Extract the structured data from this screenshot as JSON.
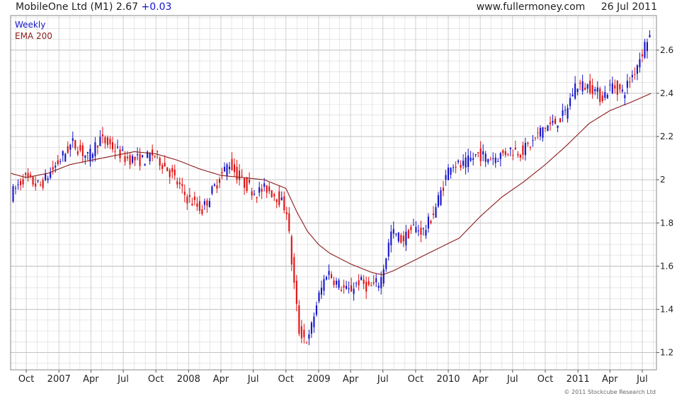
{
  "header": {
    "symbol": "MobileOne Ltd (M1)",
    "last": "2.67",
    "change": "+0.03",
    "site": "www.fullermoney.com",
    "date": "26 Jul 2011"
  },
  "footer": {
    "copyright": "© 2011 Stockcube Research Ltd"
  },
  "colors": {
    "up": "#1414c8",
    "down": "#e01010",
    "ema": "#8b1a1a",
    "grid": "#d8d8d8",
    "frame": "#888888"
  },
  "chart_data": {
    "type": "candlestick",
    "legend": {
      "placement": "top-left",
      "items": [
        {
          "label": "Weekly",
          "color": "#1414c8"
        },
        {
          "label": "EMA 200",
          "color": "#8b1a1a"
        }
      ]
    },
    "ylim": [
      1.12,
      2.76
    ],
    "yticks": [
      1.2,
      1.4,
      1.6,
      1.8,
      2.0,
      2.2,
      2.4,
      2.6
    ],
    "ytick_labels": [
      "1.2",
      "1.4",
      "1.6",
      "1.8",
      "2",
      "2.2",
      "2.4",
      "2.6"
    ],
    "xlim": [
      "2006-08-18",
      "2011-08-10"
    ],
    "xticks": [
      "2006-10-01",
      "2007-01-01",
      "2007-04-01",
      "2007-07-01",
      "2007-10-01",
      "2008-01-01",
      "2008-04-01",
      "2008-07-01",
      "2008-10-01",
      "2009-01-01",
      "2009-04-01",
      "2009-07-01",
      "2009-10-01",
      "2010-01-01",
      "2010-04-01",
      "2010-07-01",
      "2010-10-01",
      "2011-01-01",
      "2011-04-01",
      "2011-07-01"
    ],
    "xtick_labels": [
      "Oct",
      "2007",
      "Apr",
      "Jul",
      "Oct",
      "2008",
      "Apr",
      "Jul",
      "Oct",
      "2009",
      "Apr",
      "Jul",
      "Oct",
      "2010",
      "Apr",
      "Jul",
      "Oct",
      "2011",
      "Apr",
      "Jul"
    ],
    "grid": true,
    "price_keypoints": [
      [
        "2006-08-25",
        1.93
      ],
      [
        "2006-10-01",
        2.01
      ],
      [
        "2006-11-15",
        1.97
      ],
      [
        "2007-01-01",
        2.07
      ],
      [
        "2007-02-15",
        2.17
      ],
      [
        "2007-04-01",
        2.1
      ],
      [
        "2007-05-01",
        2.19
      ],
      [
        "2007-06-01",
        2.16
      ],
      [
        "2007-07-15",
        2.1
      ],
      [
        "2007-09-01",
        2.09
      ],
      [
        "2007-10-01",
        2.12
      ],
      [
        "2007-11-15",
        2.04
      ],
      [
        "2008-01-01",
        1.92
      ],
      [
        "2008-02-15",
        1.86
      ],
      [
        "2008-04-01",
        2.0
      ],
      [
        "2008-05-01",
        2.08
      ],
      [
        "2008-06-01",
        2.0
      ],
      [
        "2008-07-15",
        1.94
      ],
      [
        "2008-08-15",
        1.96
      ],
      [
        "2008-09-15",
        1.92
      ],
      [
        "2008-10-10",
        1.86
      ],
      [
        "2008-10-24",
        1.62
      ],
      [
        "2008-11-14",
        1.3
      ],
      [
        "2008-12-10",
        1.25
      ],
      [
        "2009-01-01",
        1.42
      ],
      [
        "2009-02-01",
        1.58
      ],
      [
        "2009-03-01",
        1.52
      ],
      [
        "2009-04-01",
        1.48
      ],
      [
        "2009-05-01",
        1.53
      ],
      [
        "2009-06-01",
        1.5
      ],
      [
        "2009-07-01",
        1.53
      ],
      [
        "2009-08-01",
        1.76
      ],
      [
        "2009-09-01",
        1.72
      ],
      [
        "2009-10-01",
        1.78
      ],
      [
        "2009-11-01",
        1.76
      ],
      [
        "2009-12-01",
        1.86
      ],
      [
        "2010-01-15",
        2.08
      ],
      [
        "2010-02-15",
        2.06
      ],
      [
        "2010-04-01",
        2.12
      ],
      [
        "2010-05-01",
        2.1
      ],
      [
        "2010-06-01",
        2.11
      ],
      [
        "2010-07-01",
        2.14
      ],
      [
        "2010-08-01",
        2.13
      ],
      [
        "2010-09-01",
        2.17
      ],
      [
        "2010-10-01",
        2.24
      ],
      [
        "2010-11-01",
        2.26
      ],
      [
        "2010-12-01",
        2.3
      ],
      [
        "2011-01-01",
        2.44
      ],
      [
        "2011-02-15",
        2.43
      ],
      [
        "2011-03-15",
        2.38
      ],
      [
        "2011-04-15",
        2.44
      ],
      [
        "2011-05-15",
        2.4
      ],
      [
        "2011-06-15",
        2.5
      ],
      [
        "2011-07-26",
        2.67
      ]
    ],
    "ema200_keypoints": [
      [
        "2006-08-18",
        2.03
      ],
      [
        "2006-10-01",
        2.01
      ],
      [
        "2006-12-01",
        2.03
      ],
      [
        "2007-02-01",
        2.07
      ],
      [
        "2007-04-01",
        2.09
      ],
      [
        "2007-06-01",
        2.11
      ],
      [
        "2007-08-01",
        2.13
      ],
      [
        "2007-10-01",
        2.12
      ],
      [
        "2007-12-01",
        2.09
      ],
      [
        "2008-02-01",
        2.05
      ],
      [
        "2008-04-01",
        2.02
      ],
      [
        "2008-06-01",
        2.01
      ],
      [
        "2008-08-01",
        2.0
      ],
      [
        "2008-10-01",
        1.96
      ],
      [
        "2008-11-01",
        1.85
      ],
      [
        "2008-12-01",
        1.76
      ],
      [
        "2009-01-01",
        1.7
      ],
      [
        "2009-02-01",
        1.66
      ],
      [
        "2009-04-01",
        1.61
      ],
      [
        "2009-06-01",
        1.57
      ],
      [
        "2009-07-01",
        1.56
      ],
      [
        "2009-08-01",
        1.58
      ],
      [
        "2009-10-01",
        1.63
      ],
      [
        "2009-12-01",
        1.68
      ],
      [
        "2010-02-01",
        1.73
      ],
      [
        "2010-04-01",
        1.83
      ],
      [
        "2010-06-01",
        1.92
      ],
      [
        "2010-08-01",
        1.99
      ],
      [
        "2010-10-01",
        2.07
      ],
      [
        "2010-12-01",
        2.16
      ],
      [
        "2011-02-01",
        2.26
      ],
      [
        "2011-04-01",
        2.32
      ],
      [
        "2011-06-01",
        2.36
      ],
      [
        "2011-07-26",
        2.4
      ]
    ]
  }
}
